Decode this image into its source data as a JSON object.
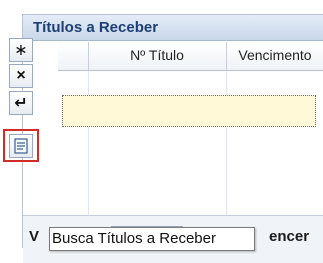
{
  "panel": {
    "title": "Títulos a Receber"
  },
  "grid": {
    "columns": [
      "Nº Título",
      "Vencimento"
    ]
  },
  "toolbar": {
    "buttons": [
      {
        "symbol": "∗",
        "icon": "asterisk-icon"
      },
      {
        "symbol": "×",
        "icon": "close-icon"
      },
      {
        "symbol": "↵",
        "icon": "enter-arrow-icon"
      },
      {
        "symbol": "",
        "icon": "search-list-icon"
      }
    ]
  },
  "footer": {
    "left_fragment": "V",
    "right_fragment": "encer"
  },
  "tooltip": {
    "text": "Busca Títulos a Receber"
  },
  "colors": {
    "highlight": "#d32a2a",
    "title_text": "#1e3f73",
    "editing_row": "#fff9d8"
  }
}
